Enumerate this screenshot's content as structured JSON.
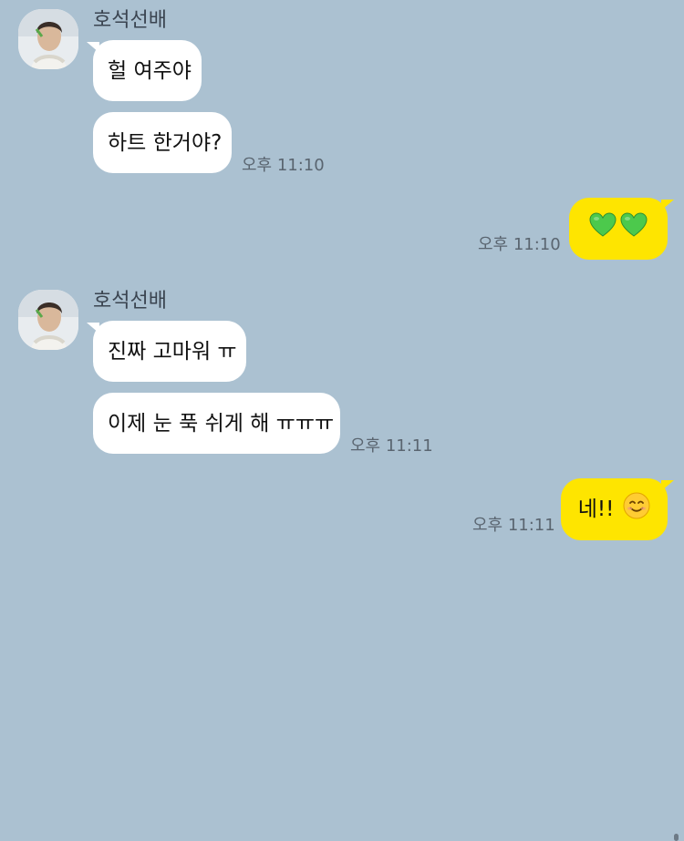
{
  "colors": {
    "background": "#abc1d1",
    "incoming_bubble": "#ffffff",
    "outgoing_bubble": "#fee500",
    "heart": "#4cc94c"
  },
  "messages": [
    {
      "sender": "호석선배",
      "texts": [
        "헐 여주야",
        "하트 한거야?"
      ],
      "time": "오후 11:10"
    },
    {
      "outgoing": true,
      "emoji": [
        "green-heart-icon",
        "green-heart-icon"
      ],
      "time": "오후 11:10"
    },
    {
      "sender": "호석선배",
      "texts": [
        "진짜 고마워 ㅠ",
        "이제 눈 푹 쉬게 해 ㅠㅠㅠ"
      ],
      "time": "오후 11:11"
    },
    {
      "outgoing": true,
      "text": "네!!",
      "emoji": [
        "smiling-face-icon"
      ],
      "time": "오후 11:11"
    }
  ]
}
